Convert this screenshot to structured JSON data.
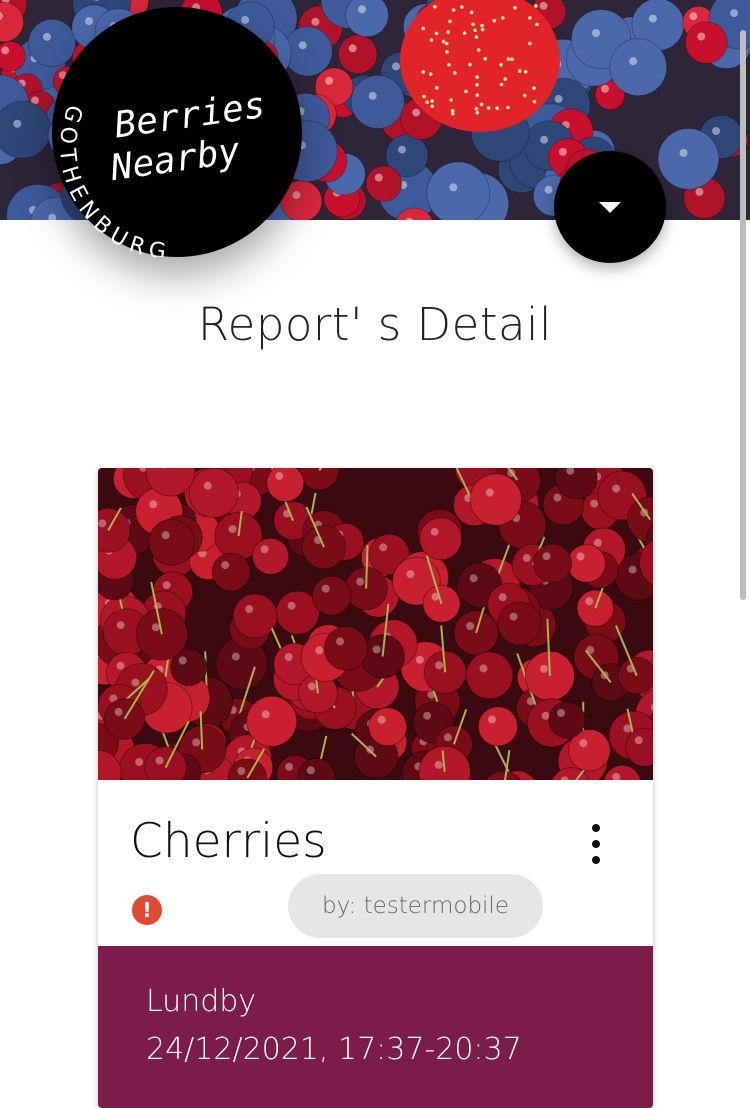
{
  "header": {
    "logo_title_line1": "Berries",
    "logo_title_line2": "Nearby",
    "logo_city": "GOTHENBURG",
    "menu_icon": "caret-down-icon"
  },
  "page": {
    "title": "Report' s Detail"
  },
  "report": {
    "berry_name": "Cherries",
    "author": "by: testermobile",
    "status_icon": "alert-icon",
    "location": "Lundby",
    "datetime": "24/12/2021, 17:37-20:37",
    "more_icon": "more-vert-icon"
  },
  "colors": {
    "details_bg": "#7b1c4a",
    "alert": "#e04a35",
    "chip_bg": "#e6e6e6"
  }
}
